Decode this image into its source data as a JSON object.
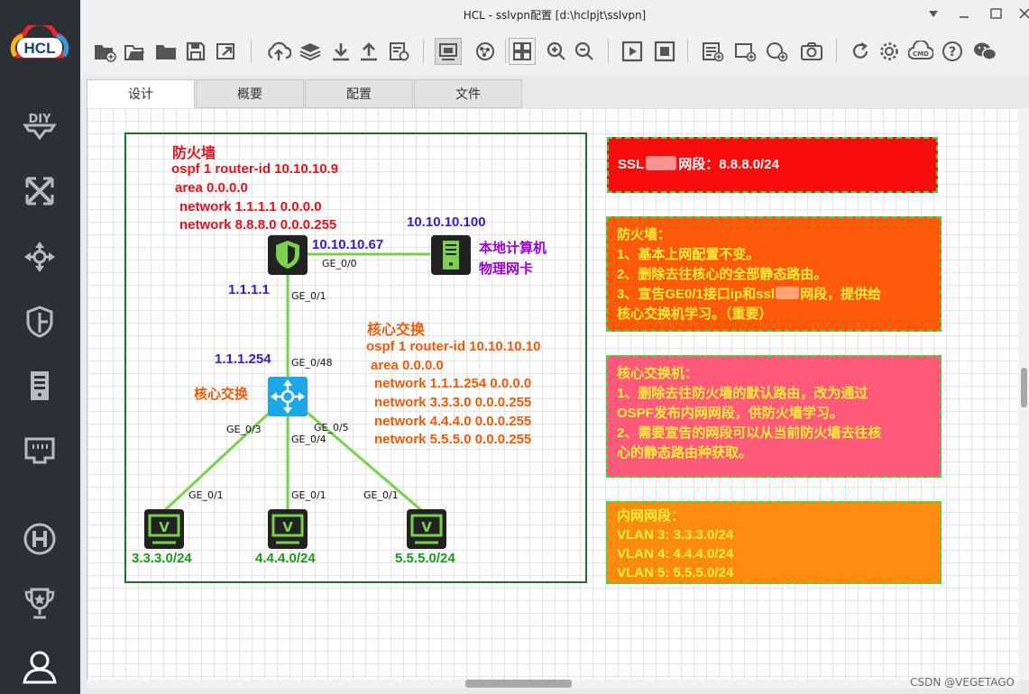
{
  "window": {
    "title": "HCL - sslvpn配置 [d:\\hclpjt\\sslvpn]"
  },
  "brand": {
    "logo_text": "HCL"
  },
  "tabs": [
    {
      "label": "设计",
      "active": true
    },
    {
      "label": "概要",
      "active": false
    },
    {
      "label": "配置",
      "active": false
    },
    {
      "label": "文件",
      "active": false
    }
  ],
  "sidebar": {
    "icons": [
      "diy-icon",
      "shuffle-icon",
      "move-icon",
      "shield-icon",
      "server-icon",
      "network-port-icon",
      "h-logo-icon",
      "trophy-icon",
      "user-icon"
    ]
  },
  "toolbar": {
    "icons": [
      "open-folder-icon",
      "open-file-icon",
      "folder-icon",
      "save-icon",
      "export-icon",
      "cloud-upload-icon",
      "layers-icon",
      "download-icon",
      "upload-icon",
      "history-icon",
      "screenshot-icon",
      "graph-icon",
      "grid-icon",
      "zoom-in-icon",
      "zoom-out-icon",
      "play-icon",
      "stop-icon",
      "add-list-icon",
      "add-rect-icon",
      "add-circle-icon",
      "camera-icon",
      "refresh-icon",
      "settings-icon",
      "cmd-icon",
      "help-icon",
      "wechat-icon"
    ]
  },
  "topology": {
    "firewall": {
      "title": "防火墙",
      "config": [
        "ospf 1 router-id 10.10.10.9",
        "area 0.0.0.0",
        "network 1.1.1.1 0.0.0.0",
        "network 8.8.8.0 0.0.0.255"
      ],
      "ip_up": "10.10.10.67",
      "ip_down": "1.1.1.1",
      "port_right": "GE_0/0",
      "port_down": "GE_0/1"
    },
    "host": {
      "ip": "10.10.10.100",
      "label_line1": "本地计算机",
      "label_line2": "物理网卡"
    },
    "core": {
      "label": "核心交换",
      "title": "核心交换",
      "config": [
        "ospf 1 router-id 10.10.10.10",
        "area 0.0.0.0",
        "network 1.1.1.254 0.0.0.0",
        "network 3.3.3.0 0.0.0.255",
        "network 4.4.4.0 0.0.0.255",
        "network 5.5.5.0 0.0.0.255"
      ],
      "ip_up": "1.1.1.254",
      "port_up": "GE_0/48",
      "port_3": "GE_0/3",
      "port_4": "GE_0/4",
      "port_5": "GE_0/5"
    },
    "pcs": [
      {
        "port": "GE_0/1",
        "net": "3.3.3.0/24"
      },
      {
        "port": "GE_0/1",
        "net": "4.4.4.0/24"
      },
      {
        "port": "GE_0/1",
        "net": "5.5.5.0/24"
      }
    ]
  },
  "notes": {
    "ssl": {
      "prefix": "SSL",
      "suffix": "网段：8.8.8.0/24",
      "bg": "#f80d0d"
    },
    "firewall": {
      "lines": [
        "防火墙：",
        "1、基本上网配置不变。",
        "2、删除去往核心的全部静态路由。",
        "3、宣告GE0/1接口ip和ssl",
        "网段，提供给",
        "核心交换机学习。（重要）"
      ],
      "bg": "#ff5b0a"
    },
    "core": {
      "lines": [
        "核心交换机：",
        "1、删除去往防火墙的默认路由，改为通过",
        "OSPF发布内网网段，供防火墙学习。",
        "2、需要宣告的网段可以从当前防火墙去往核",
        "心的静态路由种获取。"
      ],
      "bg": "#ff5a7a"
    },
    "intranet": {
      "lines": [
        "内网网段：",
        "VLAN 3:  3.3.3.0/24",
        "VLAN 4:  4.4.4.0/24",
        "VLAN 5:  5.5.5.0/24"
      ],
      "bg": "#ff8c10"
    }
  },
  "watermark": "CSDN @VEGETAGO",
  "colors": {
    "link": "#7bd050",
    "frame": "#1f6e2a",
    "sidebar": "#2b3034"
  }
}
